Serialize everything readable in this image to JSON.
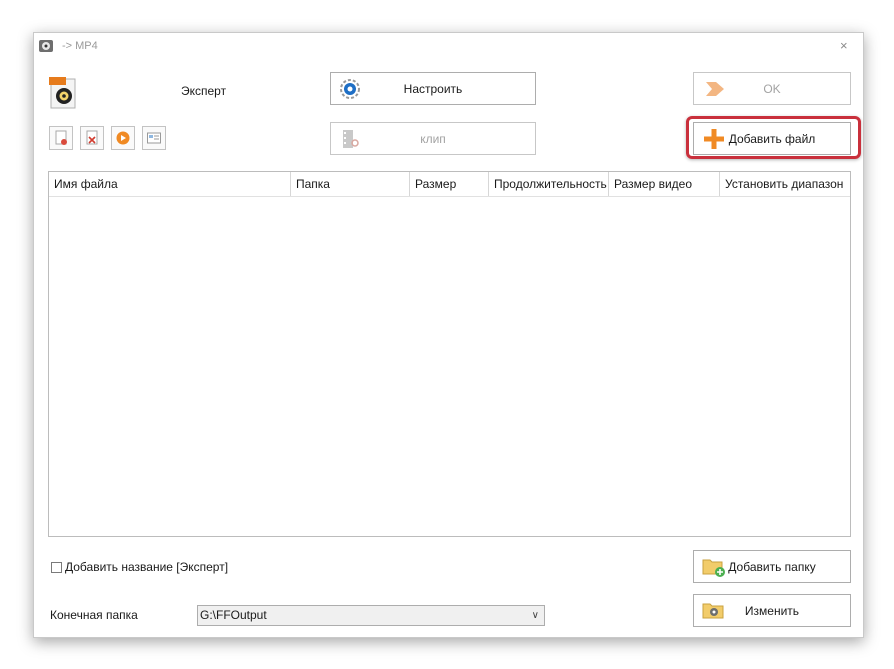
{
  "window": {
    "title": "-> MP4",
    "close_glyph": "×"
  },
  "profile": {
    "label": "Эксперт",
    "icon": "mp4-film-icon"
  },
  "buttons": {
    "settings": "Настроить",
    "ok": "OK",
    "clip": "клип",
    "add_file": "Добавить файл",
    "add_folder": "Добавить папку",
    "change": "Изменить"
  },
  "toolbar": {
    "icons": [
      "remove-file-icon",
      "delete-icon",
      "play-icon",
      "media-info-icon"
    ]
  },
  "table": {
    "columns": [
      "Имя файла",
      "Папка",
      "Размер",
      "Продолжительность",
      "Размер видео",
      "Установить диапазон"
    ],
    "rows": []
  },
  "options": {
    "add_name_label": "Добавить название [Эксперт]",
    "add_name_checked": false
  },
  "output": {
    "label": "Конечная папка",
    "path": "G:\\FFOutput",
    "arrow": "∨"
  },
  "colors": {
    "highlight": "#c9303c",
    "plus_orange": "#f08a24",
    "ok_arrow": "#f3b682"
  }
}
